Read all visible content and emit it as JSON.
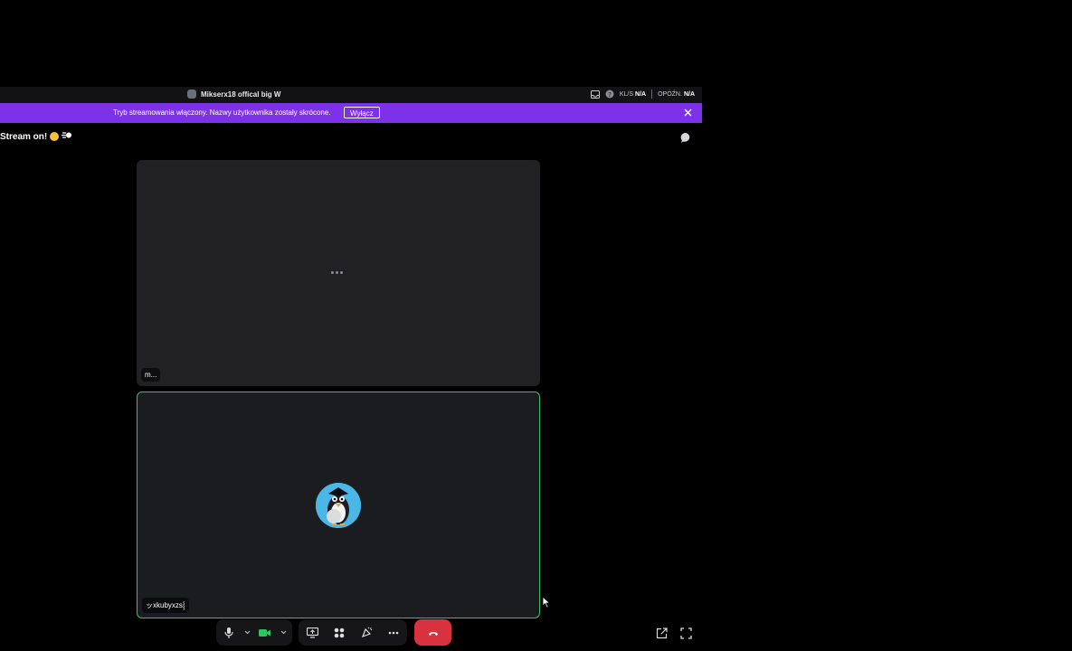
{
  "titlebar": {
    "title": "Mikserx18 offical big W",
    "stat1_label": "KL/S",
    "stat1_value": "N/A",
    "stat2_label": "OPÓŹN.",
    "stat2_value": "N/A",
    "icons": [
      "inbox-icon",
      "help-icon",
      "minimize-icon",
      "maximize-icon",
      "close-icon"
    ]
  },
  "banner": {
    "text": "Tryb streamowania włączony. Nazwy użytkownika zostały skrócone.",
    "button_label": "Wyłącz",
    "bg_color": "#7d31e8"
  },
  "channel": {
    "name": "Stream on!",
    "emojis": [
      "astonished-face-emoji",
      "dashing-away-emoji"
    ]
  },
  "tiles": [
    {
      "name_label": "m...",
      "state": "loading"
    },
    {
      "name_label": "ッxkubyxzs⸾",
      "state": "speaking",
      "border_color": "#2fc561"
    }
  ],
  "controls": {
    "buttons": [
      "microphone-icon",
      "mic-options-chevron-icon",
      "camera-icon",
      "camera-options-chevron-icon",
      "screen-share-icon",
      "activities-icon",
      "soundboard-icon",
      "more-options-icon",
      "disconnect-icon",
      "popout-icon",
      "fullscreen-icon"
    ],
    "camera_color": "#2fc561",
    "hangup_color": "#d8323f"
  }
}
